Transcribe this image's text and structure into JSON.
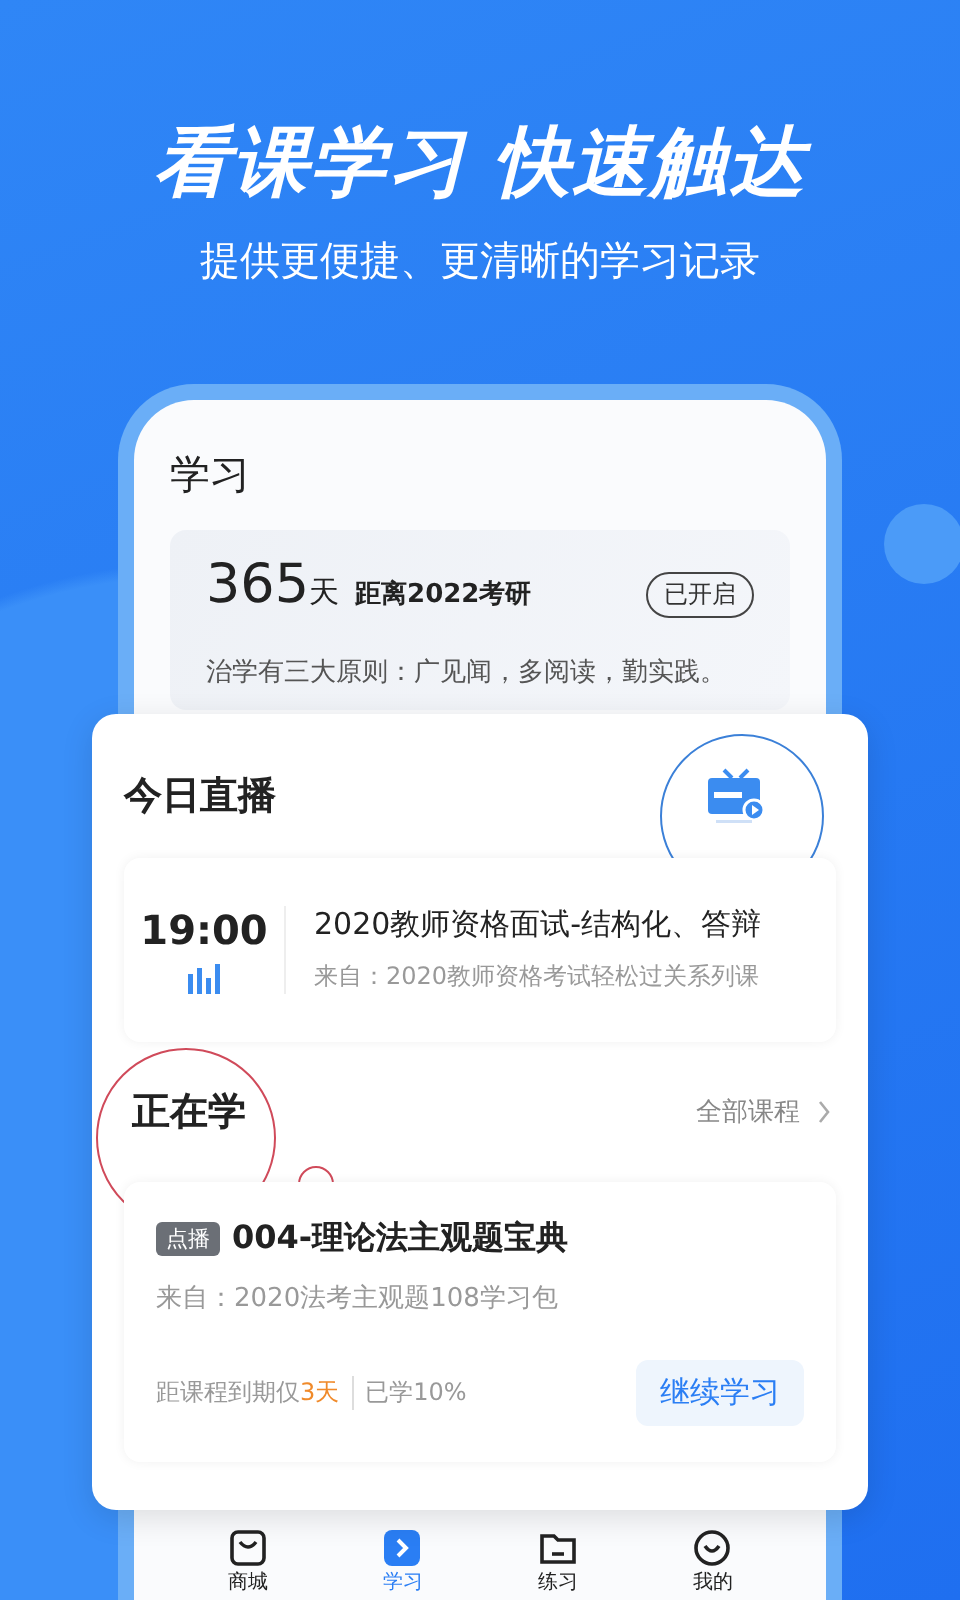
{
  "headline": "看课学习 快速触达",
  "subtitle": "提供更便捷、更清晰的学习记录",
  "screen_title": "学习",
  "countdown": {
    "days": "365",
    "unit": "天",
    "target": "距离2022考研",
    "status": "已开启",
    "motto": "治学有三大原则：广见闻，多阅读，勤实践。"
  },
  "live": {
    "title": "今日直播",
    "items": [
      {
        "time": "19:00",
        "title": "2020教师资格面试-结构化、答辩",
        "source": "来自：2020教师资格考试轻松过关系列课"
      }
    ]
  },
  "studying": {
    "title": "正在学",
    "link": "全部课程",
    "courses": [
      {
        "tag": "点播",
        "title": "004-理论法主观题宝典",
        "source": "来自：2020法考主观题108学习包",
        "expiry_prefix": "距课程到期仅",
        "expiry_days": "3天",
        "progress": "已学10%",
        "action": "继续学习"
      }
    ]
  },
  "tabs": [
    {
      "label": "商城",
      "kind": "shop",
      "selected": false
    },
    {
      "label": "学习",
      "kind": "study",
      "selected": true
    },
    {
      "label": "练习",
      "kind": "practice",
      "selected": false
    },
    {
      "label": "我的",
      "kind": "profile",
      "selected": false
    }
  ]
}
